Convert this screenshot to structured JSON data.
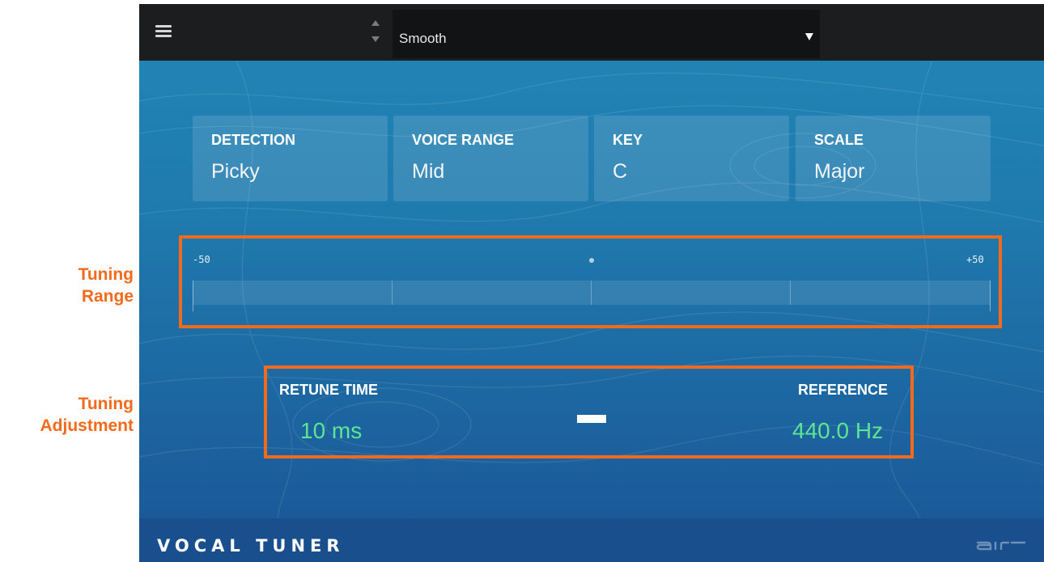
{
  "annotations": {
    "tuning_range": "Tuning\nRange",
    "tuning_adjustment": "Tuning\nAdjustment"
  },
  "toolbar": {
    "menu_icon": "hamburger-icon",
    "preset": "Smooth"
  },
  "params": [
    {
      "title": "DETECTION",
      "value": "Picky"
    },
    {
      "title": "VOICE RANGE",
      "value": "Mid"
    },
    {
      "title": "KEY",
      "value": "C"
    },
    {
      "title": "SCALE",
      "value": "Major"
    }
  ],
  "range": {
    "min": "-50",
    "max": "+50"
  },
  "adjust": {
    "retune_title": "RETUNE TIME",
    "retune_value": "10 ms",
    "reference_title": "REFERENCE",
    "reference_value": "440.0 Hz"
  },
  "footer": {
    "product": "VOCAL TUNER",
    "logo": "air-logo"
  },
  "colors": {
    "accent_annotation": "#f26b1d",
    "value_green": "#5ee592",
    "panel_blue": "#1f79ad",
    "toolbar": "#1c1d1f"
  }
}
